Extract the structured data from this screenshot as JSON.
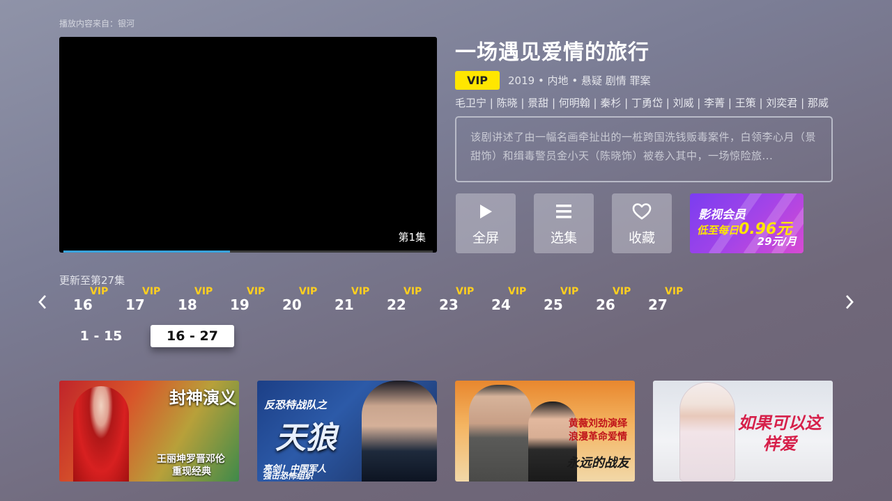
{
  "source": "播放内容来自：银河",
  "player": {
    "episode_label": "第1集",
    "progress": 0.45
  },
  "show": {
    "title": "一场遇见爱情的旅行",
    "vip_label": "VIP",
    "meta": "2019 • 内地 • 悬疑 剧情 罪案",
    "cast": "毛卫宁 | 陈晓 | 景甜 | 何明翰 | 秦杉 | 丁勇岱 | 刘威 | 李菁 | 王策 | 刘奕君 | 那威",
    "description": "该剧讲述了由一幅名画牵扯出的一桩跨国洗钱贩毒案件，白领李心月（景甜饰）和缉毒警员金小天（陈晓饰）被卷入其中，一场惊险旅..."
  },
  "actions": {
    "fullscreen": {
      "label": "全屏",
      "icon": "play-icon"
    },
    "episodes": {
      "label": "选集",
      "icon": "list-icon"
    },
    "favorite": {
      "label": "收藏",
      "icon": "heart-icon"
    }
  },
  "promo": {
    "line1": "影视会员",
    "line2_prefix": "低至每日",
    "line2_price": "0.96元",
    "line3": "29元/月"
  },
  "update_text": "更新至第27集",
  "episodes": [
    {
      "num": "16",
      "badge": "VIP"
    },
    {
      "num": "17",
      "badge": "VIP"
    },
    {
      "num": "18",
      "badge": "VIP"
    },
    {
      "num": "19",
      "badge": "VIP"
    },
    {
      "num": "20",
      "badge": "VIP"
    },
    {
      "num": "21",
      "badge": "VIP"
    },
    {
      "num": "22",
      "badge": "VIP"
    },
    {
      "num": "23",
      "badge": "VIP"
    },
    {
      "num": "24",
      "badge": "VIP"
    },
    {
      "num": "25",
      "badge": "VIP"
    },
    {
      "num": "26",
      "badge": "VIP"
    },
    {
      "num": "27",
      "badge": "VIP"
    }
  ],
  "ranges": [
    {
      "label": "1 - 15",
      "active": false
    },
    {
      "label": "16 - 27",
      "active": true
    }
  ],
  "recommendations": [
    {
      "title": "封神演义",
      "caption_line1": "王丽坤罗晋邓伦",
      "caption_line2": "重现经典"
    },
    {
      "title": "天狼",
      "banner": "反恐特战队之",
      "caption_line1": "亮剑！中国军人",
      "caption_line2": "强击恐怖组织"
    },
    {
      "title": "永远的战友",
      "caption_line1": "黄薇刘劲演绎",
      "caption_line2": "浪漫革命爱情"
    },
    {
      "title": "如果可以这样爱"
    }
  ],
  "colors": {
    "vip_yellow": "#ffe600",
    "progress_blue": "#39a3dc",
    "episode_vip": "#ffcf1f"
  }
}
